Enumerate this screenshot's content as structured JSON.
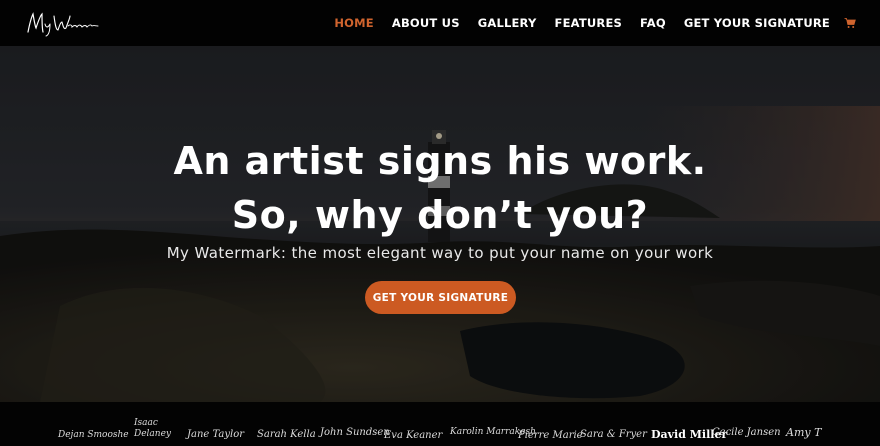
{
  "header": {
    "logo_text": "My Watermark",
    "nav": [
      {
        "label": "HOME",
        "active": true
      },
      {
        "label": "ABOUT US",
        "active": false
      },
      {
        "label": "GALLERY",
        "active": false
      },
      {
        "label": "FEATURES",
        "active": false
      },
      {
        "label": "FAQ",
        "active": false
      },
      {
        "label": "GET YOUR SIGNATURE",
        "active": false
      }
    ],
    "cart_icon": "cart-icon",
    "accent_color": "#d0642e"
  },
  "hero": {
    "title_line1": "An artist signs his work.",
    "title_line2": "So, why don’t you?",
    "subtitle": "My Watermark: the most elegant way to put your name on your work",
    "cta_label": "GET YOUR SIGNATURE",
    "cta_color": "#cc5a22"
  },
  "signatures": [
    "Dejan Smooshe",
    "Isaac Delaney",
    "Jane Taylor",
    "Sarah Kella",
    "John Sundsen",
    "Eva Keaner",
    "Karolin Marrakesh",
    "Pierre Marie",
    "Sara & Fryer",
    "David Miller",
    "Cecile Jansen",
    "Amy T"
  ]
}
